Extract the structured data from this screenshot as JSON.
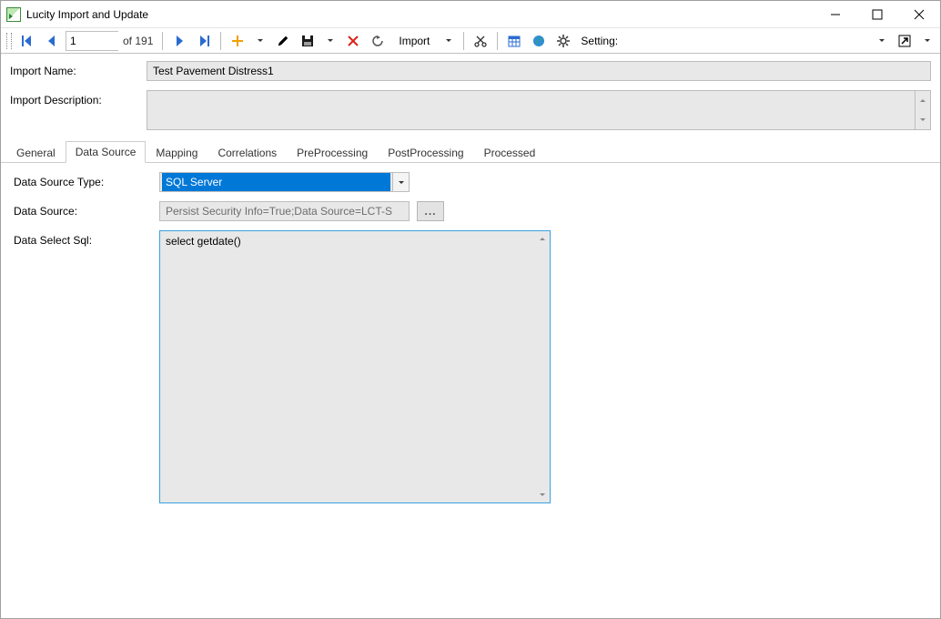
{
  "window_title": "Lucity Import and Update",
  "toolbar": {
    "page_current": "1",
    "page_total": "of 191",
    "import_label": "Import",
    "setting_label": "Setting:"
  },
  "fields": {
    "import_name_label": "Import Name:",
    "import_name_value": "Test Pavement Distress1",
    "import_desc_label": "Import Description:",
    "import_desc_value": ""
  },
  "tabs": [
    {
      "label": "General"
    },
    {
      "label": "Data Source",
      "active": true
    },
    {
      "label": "Mapping"
    },
    {
      "label": "Correlations"
    },
    {
      "label": "PreProcessing"
    },
    {
      "label": "PostProcessing"
    },
    {
      "label": "Processed"
    }
  ],
  "data_source_tab": {
    "type_label": "Data Source Type:",
    "type_value": "SQL Server",
    "source_label": "Data Source:",
    "source_value": "Persist Security Info=True;Data Source=LCT-S",
    "browse_label": "...",
    "sql_label": "Data Select Sql:",
    "sql_value": "select getdate()"
  },
  "colors": {
    "highlight": "#0078d7",
    "focus_border": "#3aa0e0",
    "field_bg": "#e8e8e8",
    "nav_blue": "#2a6bd1"
  }
}
